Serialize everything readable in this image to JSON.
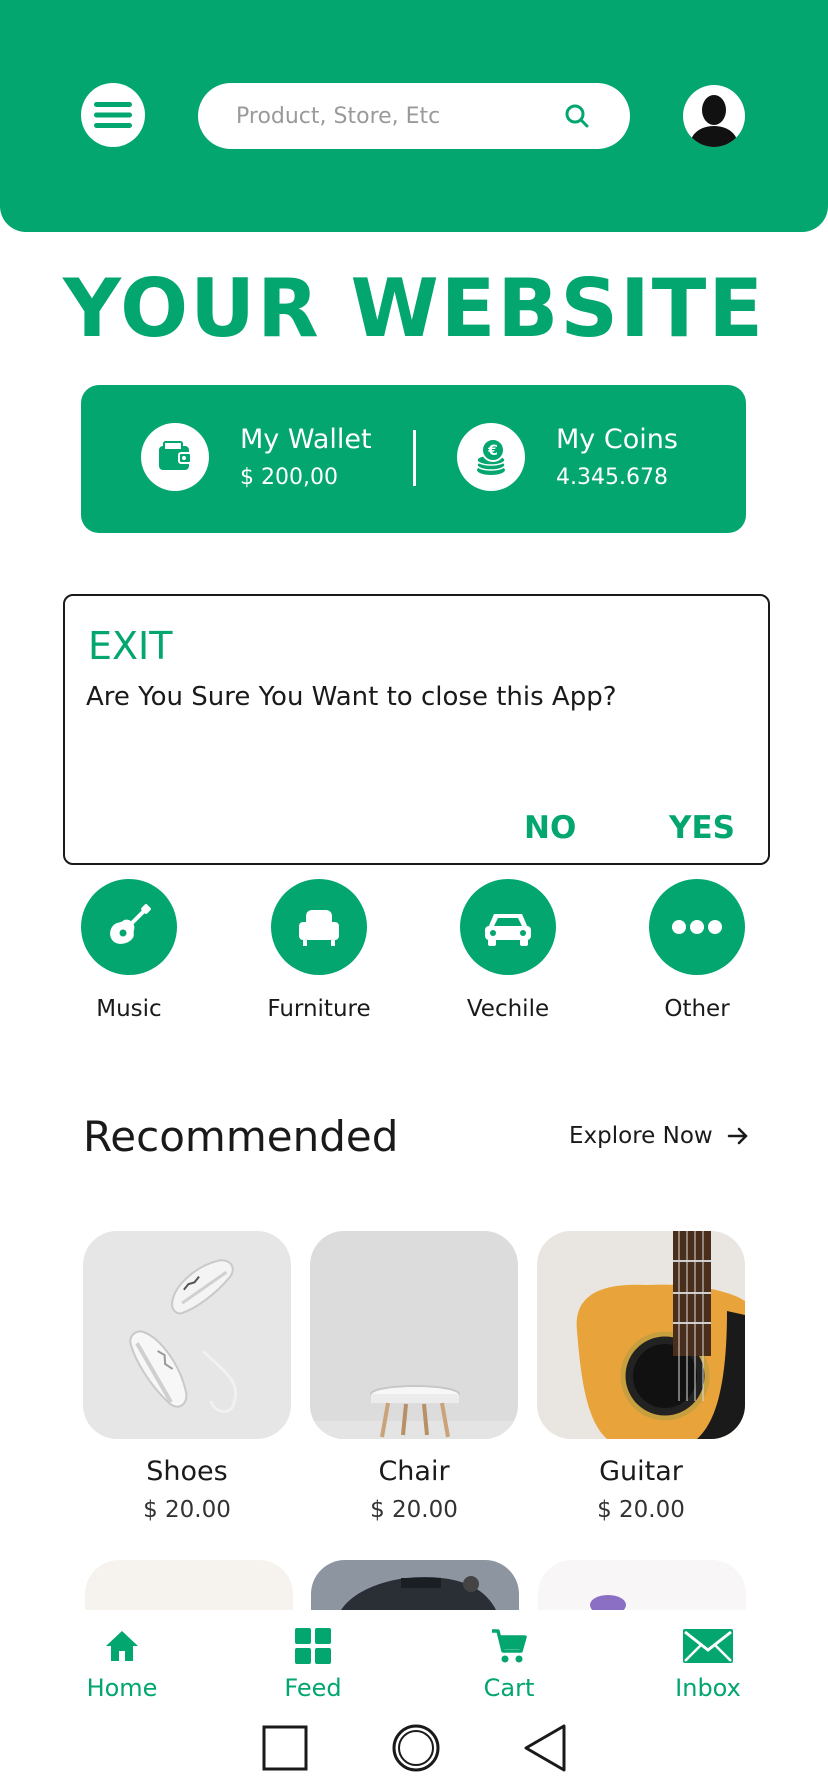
{
  "header": {
    "search": {
      "placeholder": "Product, Store, Etc"
    }
  },
  "site_title": "YOUR WEBSITE",
  "balance": {
    "wallet": {
      "label": "My Wallet",
      "value": "$ 200,00"
    },
    "coins": {
      "label": "My Coins",
      "value": "4.345.678"
    }
  },
  "dialog": {
    "title": "EXIT",
    "message": "Are You Sure You Want to close this App?",
    "no_label": "NO",
    "yes_label": "YES"
  },
  "categories": [
    {
      "label": "Music",
      "icon": "guitar-icon"
    },
    {
      "label": "Furniture",
      "icon": "armchair-icon"
    },
    {
      "label": "Vechile",
      "icon": "car-icon"
    },
    {
      "label": "Other",
      "icon": "more-dots-icon"
    }
  ],
  "recommended": {
    "title": "Recommended",
    "explore_label": "Explore Now",
    "products": [
      {
        "name": "Shoes",
        "price": "$ 20.00"
      },
      {
        "name": "Chair",
        "price": "$ 20.00"
      },
      {
        "name": "Guitar",
        "price": "$ 20.00"
      }
    ]
  },
  "tabbar": [
    {
      "label": "Home",
      "icon": "home-icon"
    },
    {
      "label": "Feed",
      "icon": "grid-icon"
    },
    {
      "label": "Cart",
      "icon": "cart-icon"
    },
    {
      "label": "Inbox",
      "icon": "mail-icon"
    }
  ],
  "colors": {
    "accent": "#03A66E",
    "text": "#1a1a1a",
    "background": "#ffffff"
  }
}
